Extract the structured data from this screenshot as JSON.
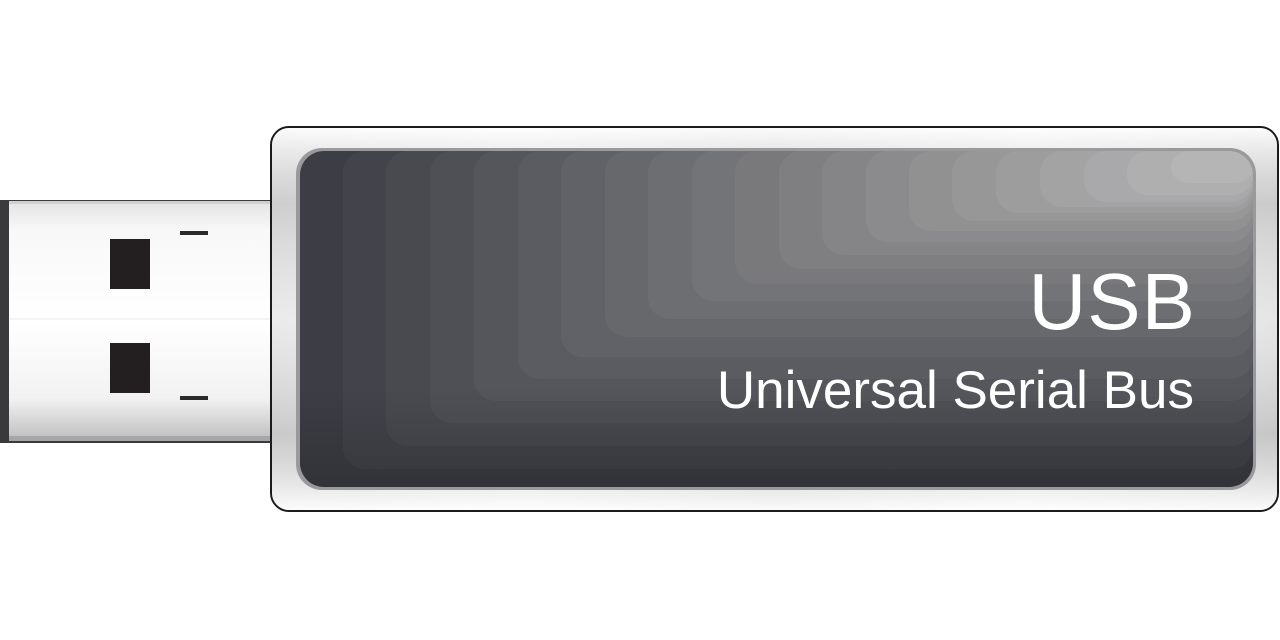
{
  "device": {
    "label": "USB",
    "sublabel": "Universal Serial Bus"
  },
  "colors": {
    "background": "#ffffff",
    "panel_dark": "#3d3e45",
    "panel_light": "#a9a9ab",
    "metal_light": "#fafafa",
    "metal_shadow": "#b5b5b7",
    "pin_holes": "#231f20",
    "text": "#ffffff"
  }
}
